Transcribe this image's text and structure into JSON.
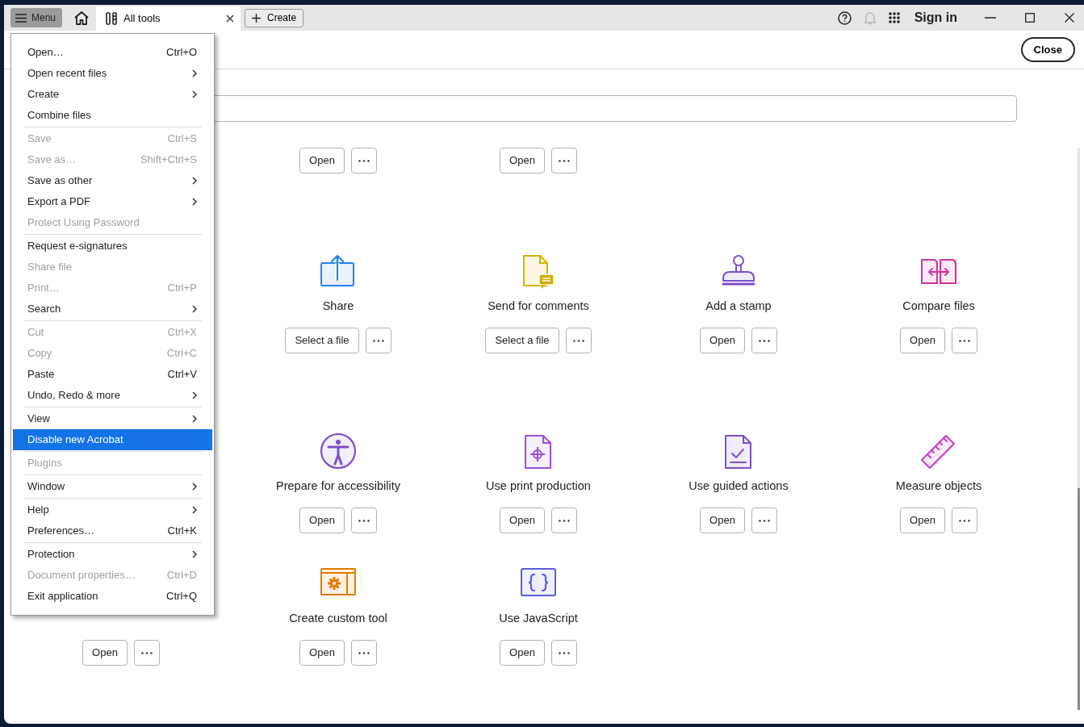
{
  "window": {
    "menu_button": "Menu",
    "tabs": [
      {
        "label": "All tools",
        "selected": true
      }
    ],
    "create_button": "Create",
    "sign_in": "Sign in"
  },
  "header": {
    "close_button": "Close"
  },
  "tool_rows": [
    [
      {
        "kind": "empty"
      },
      {
        "kind": "hidden",
        "action": "Open"
      },
      {
        "kind": "hidden",
        "action": "Open"
      }
    ],
    [
      {
        "kind": "empty"
      },
      {
        "kind": "share",
        "label": "Share",
        "action": "Select a file"
      },
      {
        "kind": "comment",
        "label": "Send for comments",
        "action": "Select a file"
      },
      {
        "kind": "stamp",
        "label": "Add a stamp",
        "action": "Open"
      },
      {
        "kind": "compare",
        "label": "Compare files",
        "action": "Open"
      }
    ],
    [
      {
        "kind": "empty"
      },
      {
        "kind": "accessibility",
        "label": "Prepare for accessibility",
        "action": "Open"
      },
      {
        "kind": "print",
        "label": "Use print production",
        "action": "Open"
      },
      {
        "kind": "guided",
        "label": "Use guided actions",
        "action": "Open"
      },
      {
        "kind": "measure",
        "label": "Measure objects",
        "action": "Open"
      }
    ],
    [
      {
        "kind": "hidden",
        "action": "Open"
      },
      {
        "kind": "custom",
        "label": "Create custom tool",
        "action": "Open"
      },
      {
        "kind": "javascript",
        "label": "Use JavaScript",
        "action": "Open"
      }
    ]
  ],
  "menu": {
    "groups": [
      [
        {
          "label": "Open…",
          "shortcut": "Ctrl+O",
          "submenu": false,
          "disabled": false,
          "selected": false
        },
        {
          "label": "Open recent files",
          "submenu": true,
          "disabled": false,
          "selected": false
        },
        {
          "label": "Create",
          "submenu": true,
          "disabled": false,
          "selected": false
        },
        {
          "label": "Combine files",
          "submenu": false,
          "disabled": false,
          "selected": false
        }
      ],
      [
        {
          "label": "Save",
          "shortcut": "Ctrl+S",
          "submenu": false,
          "disabled": true,
          "selected": false
        },
        {
          "label": "Save as…",
          "shortcut": "Shift+Ctrl+S",
          "submenu": false,
          "disabled": true,
          "selected": false
        },
        {
          "label": "Save as other",
          "submenu": true,
          "disabled": false,
          "selected": false
        },
        {
          "label": "Export a PDF",
          "submenu": true,
          "disabled": false,
          "selected": false
        },
        {
          "label": "Protect Using Password",
          "submenu": false,
          "disabled": true,
          "selected": false
        }
      ],
      [
        {
          "label": "Request e-signatures",
          "submenu": false,
          "disabled": false,
          "selected": false
        },
        {
          "label": "Share file",
          "submenu": false,
          "disabled": true,
          "selected": false
        },
        {
          "label": "Print…",
          "shortcut": "Ctrl+P",
          "submenu": false,
          "disabled": true,
          "selected": false
        },
        {
          "label": "Search",
          "submenu": true,
          "disabled": false,
          "selected": false
        }
      ],
      [
        {
          "label": "Cut",
          "shortcut": "Ctrl+X",
          "submenu": false,
          "disabled": true,
          "selected": false
        },
        {
          "label": "Copy",
          "shortcut": "Ctrl+C",
          "submenu": false,
          "disabled": true,
          "selected": false
        },
        {
          "label": "Paste",
          "shortcut": "Ctrl+V",
          "submenu": false,
          "disabled": false,
          "selected": false
        },
        {
          "label": "Undo, Redo & more",
          "submenu": true,
          "disabled": false,
          "selected": false
        }
      ],
      [
        {
          "label": "View",
          "submenu": true,
          "disabled": false,
          "selected": false
        },
        {
          "label": "Disable new Acrobat",
          "submenu": false,
          "disabled": false,
          "selected": true
        }
      ],
      [
        {
          "label": "Plugins",
          "submenu": false,
          "disabled": true,
          "selected": false
        }
      ],
      [
        {
          "label": "Window",
          "submenu": true,
          "disabled": false,
          "selected": false
        }
      ],
      [
        {
          "label": "Help",
          "submenu": true,
          "disabled": false,
          "selected": false
        },
        {
          "label": "Preferences…",
          "shortcut": "Ctrl+K",
          "submenu": false,
          "disabled": false,
          "selected": false
        }
      ],
      [
        {
          "label": "Protection",
          "submenu": true,
          "disabled": false,
          "selected": false
        },
        {
          "label": "Document properties…",
          "shortcut": "Ctrl+D",
          "submenu": false,
          "disabled": true,
          "selected": false
        },
        {
          "label": "Exit application",
          "shortcut": "Ctrl+Q",
          "submenu": false,
          "disabled": false,
          "selected": false
        }
      ]
    ]
  }
}
